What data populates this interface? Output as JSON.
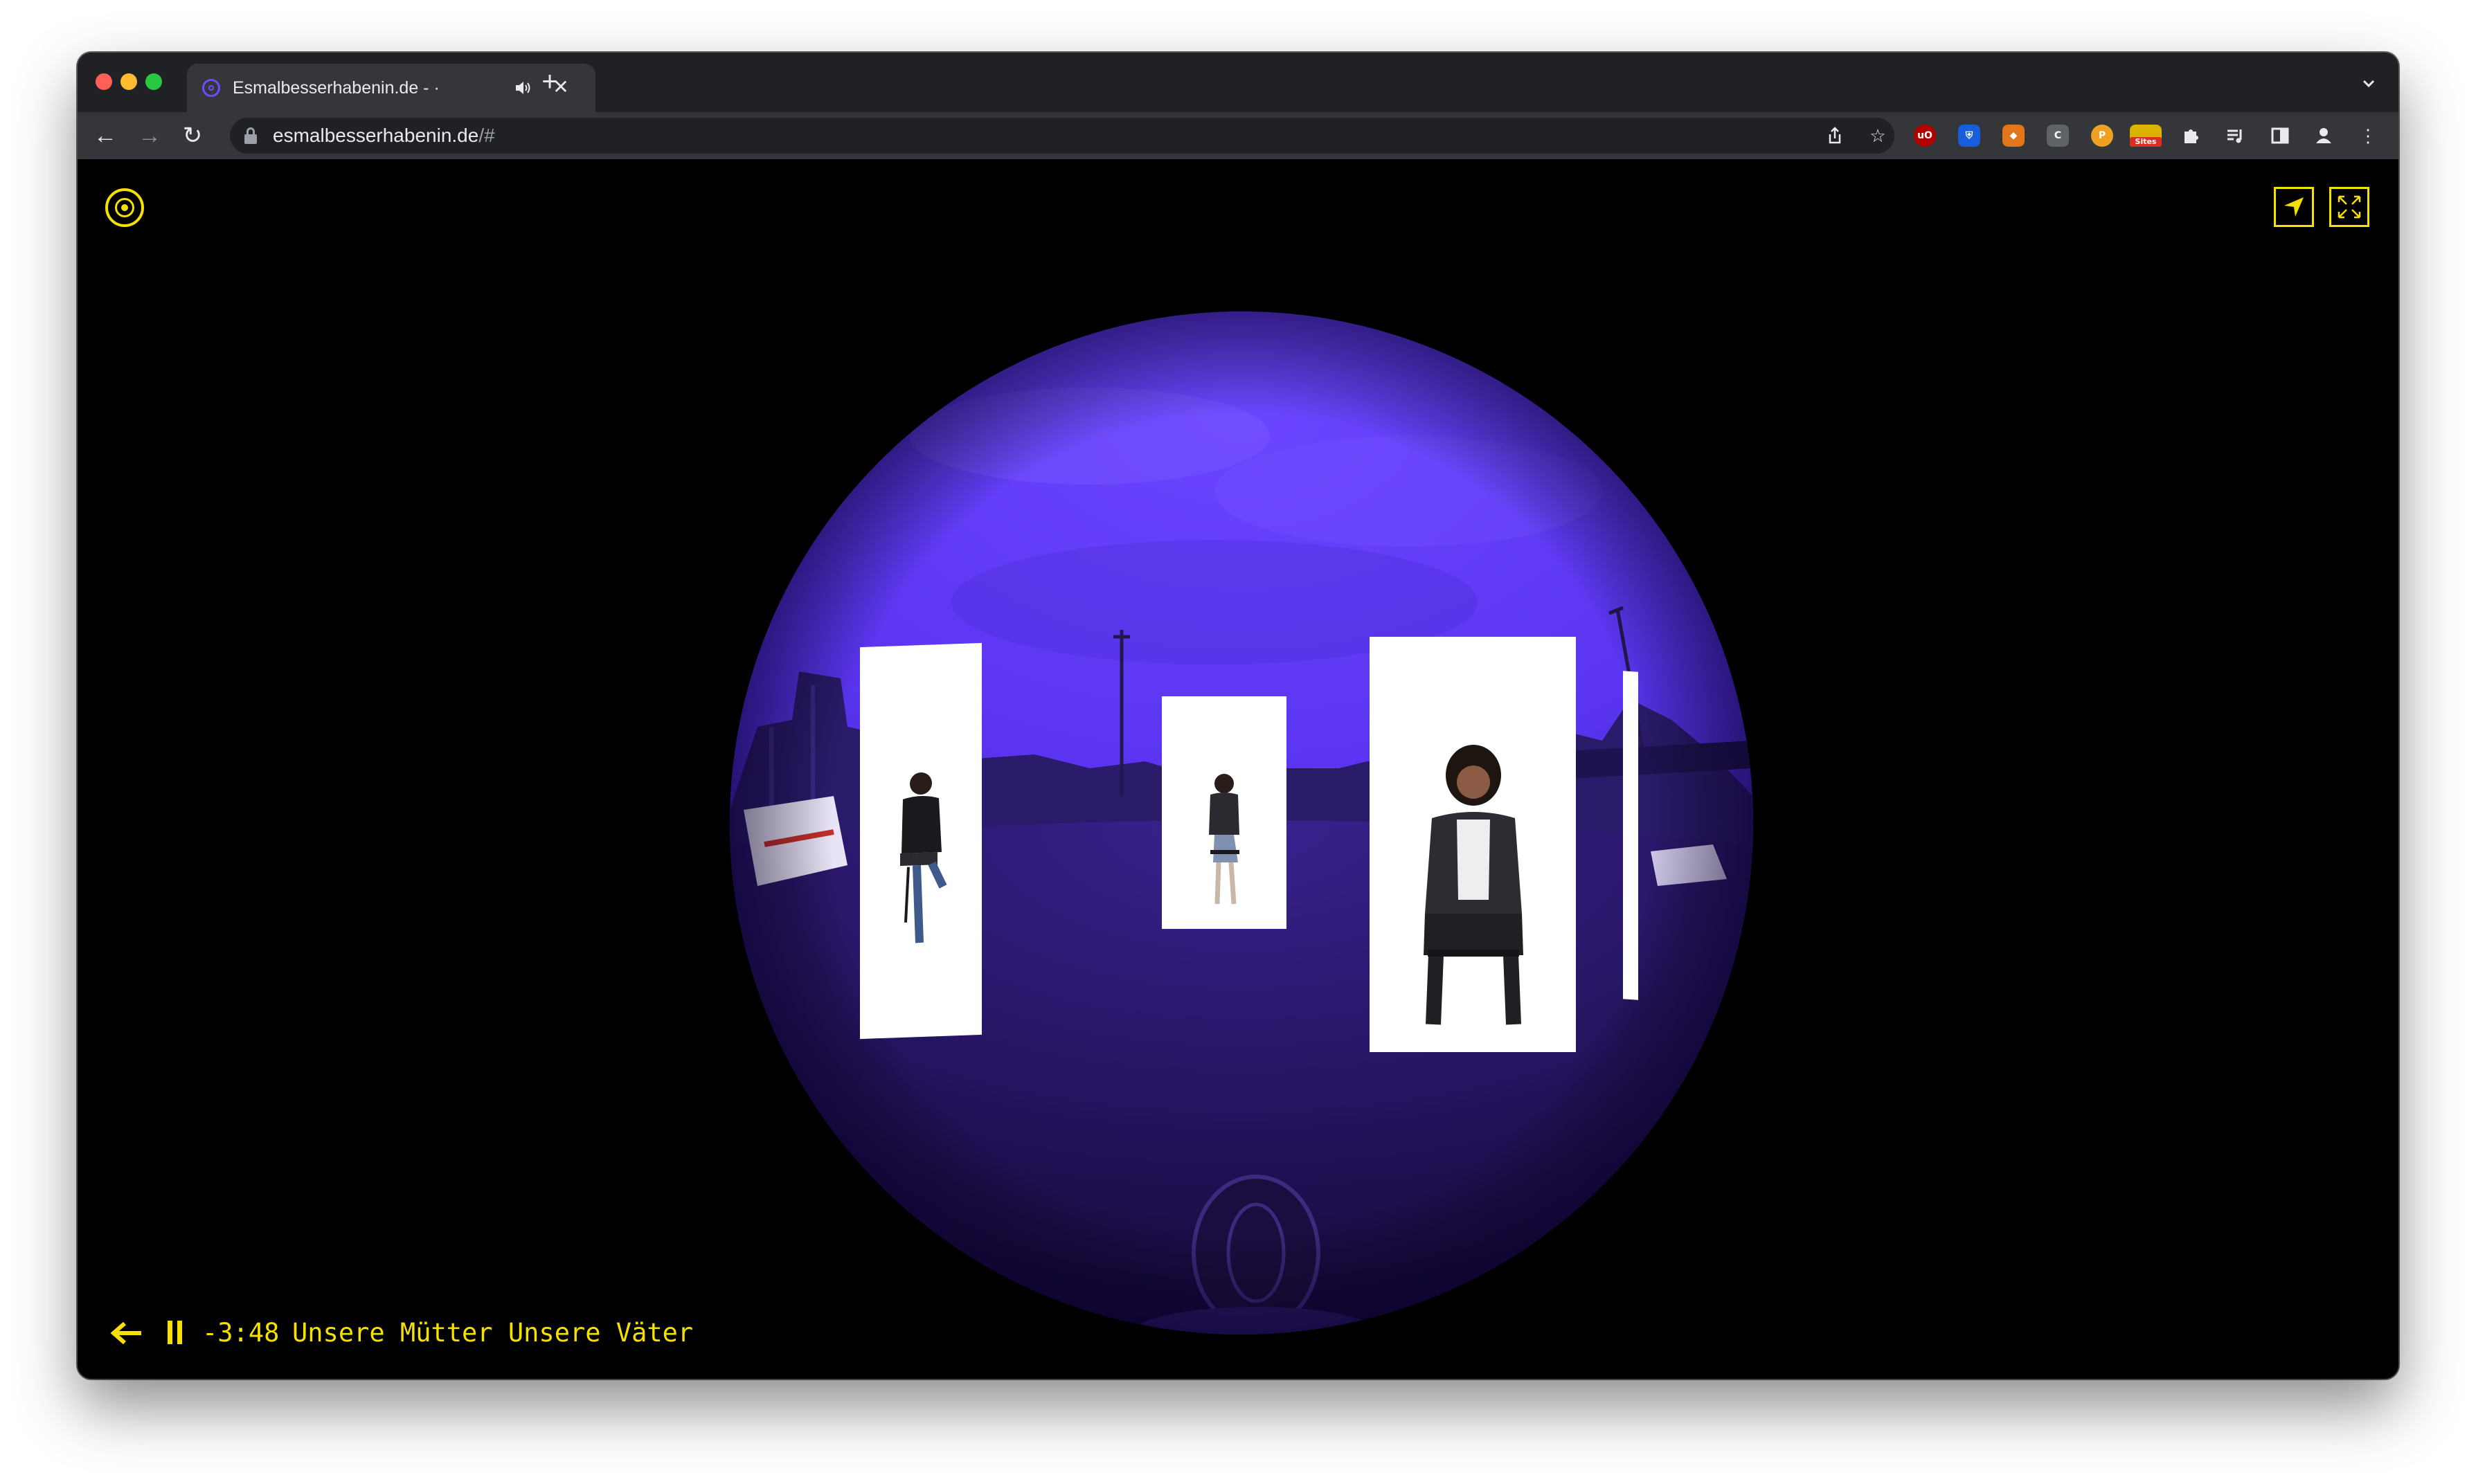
{
  "browser": {
    "tab": {
      "title": "Esmalbesserhabenin.de - ·",
      "favicon": "target-icon",
      "audio_icon": "speaker-icon",
      "close": "✕"
    },
    "new_tab": "+",
    "tab_search": "⌄",
    "nav": {
      "back": "←",
      "forward": "→",
      "reload": "↻"
    },
    "address": {
      "host": "esmalbesserhabenin.de",
      "path": "/#"
    },
    "omnibox_icons": {
      "share": "⇧",
      "bookmark": "☆"
    },
    "extensions": [
      {
        "name": "ublock-icon",
        "label": "uO",
        "color": "#b30000"
      },
      {
        "name": "bitwarden-icon",
        "label": "⛨",
        "color": "#175ddc"
      },
      {
        "name": "metamask-icon",
        "label": "◆",
        "color": "#e2761b"
      },
      {
        "name": "c-extension-icon",
        "label": "C",
        "color": "#5f6368"
      },
      {
        "name": "p-extension-icon",
        "label": "P",
        "color": "#f0a020"
      },
      {
        "name": "sites-extension-icon",
        "label": "Sites",
        "color": "#d9b300"
      }
    ],
    "toolbar_icons": {
      "puzzle": "✦",
      "media": "≡",
      "sidepanel": "◧",
      "profile": "●",
      "menu": "⋮"
    }
  },
  "page": {
    "accent_color": "#f5e000",
    "sphere_color": "#5a34f0",
    "player": {
      "time": "-3:48",
      "title": "Unsere Mütter Unsere Väter"
    }
  }
}
